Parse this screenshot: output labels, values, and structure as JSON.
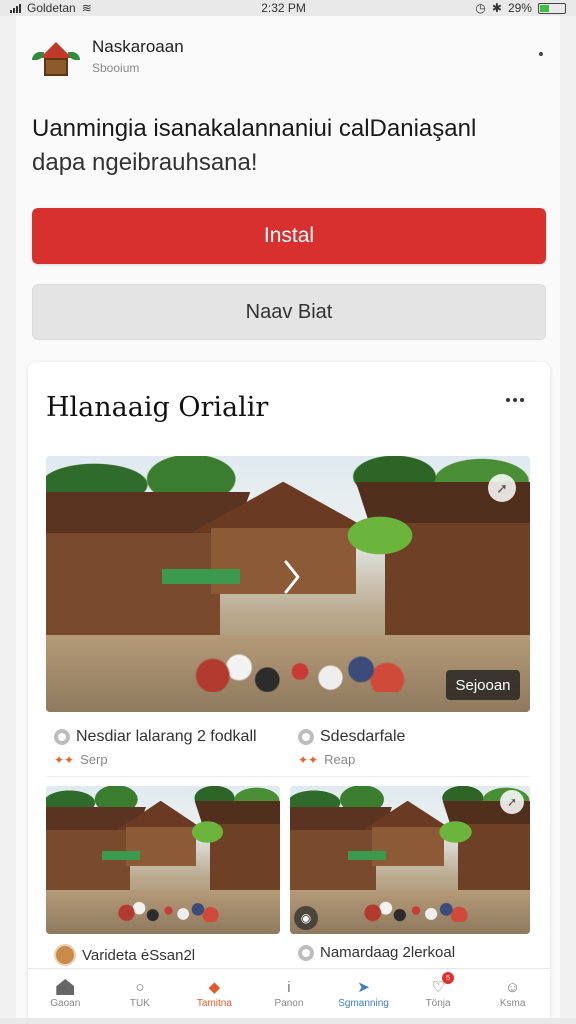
{
  "status_bar": {
    "carrier": "Goldetan",
    "time": "2:32 PM",
    "battery": "29%"
  },
  "app": {
    "name": "Naskaroaan",
    "subtitle": "Sbooium"
  },
  "headline": {
    "line1": "Uanmingia isanakalannaniui calDaniaşanl",
    "line2": "dapa ngeibrauhsana!"
  },
  "buttons": {
    "install": "Instal",
    "secondary": "Naav Biat"
  },
  "panel": {
    "title": "Hlanaaig Orialir",
    "main_overlay_label": "Sejooan",
    "main_meta": [
      {
        "title": "Nesdiar lalarang 2 fodkall",
        "sub": "Serp"
      },
      {
        "title": "Sdesdarfale",
        "sub": "Reap"
      }
    ],
    "small_meta": [
      {
        "title": "Varideta ėSsan2l"
      },
      {
        "title": "Namardaag 2lerkoal"
      }
    ]
  },
  "bottom_nav": [
    {
      "label": "Gaoan",
      "icon": "home-icon"
    },
    {
      "label": "TUK",
      "icon": "search-icon"
    },
    {
      "label": "Tamitna",
      "icon": "trending-icon"
    },
    {
      "label": "Panon",
      "icon": "info-icon"
    },
    {
      "label": "Sgmanning",
      "icon": "send-icon"
    },
    {
      "label": "Tönja",
      "icon": "heart-icon",
      "badge": "5"
    },
    {
      "label": "Ksma",
      "icon": "profile-icon"
    }
  ],
  "colors": {
    "primary": "#d8302e",
    "active_nav": "#e15a2b",
    "secondary_bg": "#e4e4e4"
  }
}
